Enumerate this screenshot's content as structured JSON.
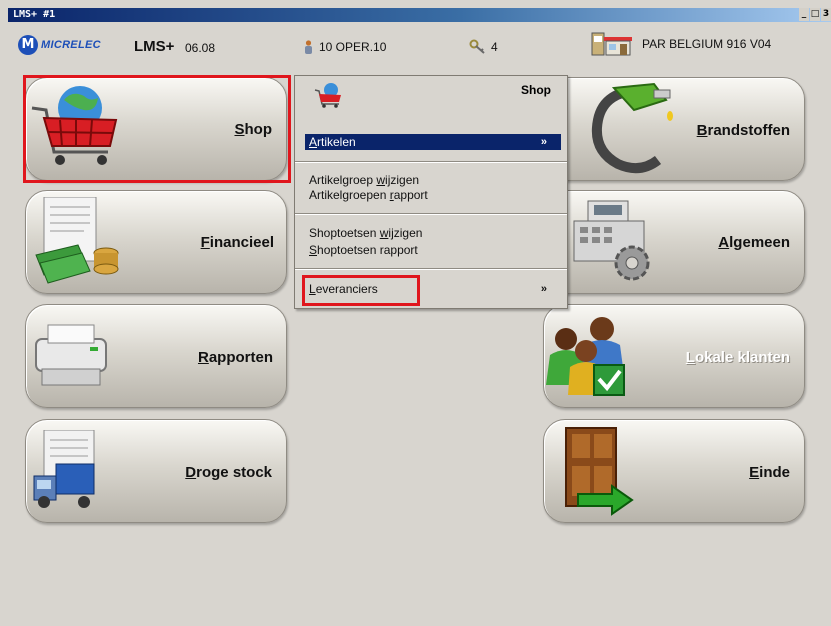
{
  "window": {
    "title": "LMS+  #1",
    "controls": [
      "_",
      "&",
      "3"
    ]
  },
  "header": {
    "logo_text": "MICRELEC",
    "app_name": "LMS+",
    "app_version": "06.08",
    "operator": "10  OPER.10",
    "key_count": "4",
    "station": "PAR BELGIUM 916 V04"
  },
  "tiles": {
    "shop": {
      "prefix": "",
      "ul": "S",
      "rest": "hop"
    },
    "financieel": {
      "prefix": "",
      "ul": "F",
      "rest": "inancieel"
    },
    "rapporten": {
      "prefix": "",
      "ul": "R",
      "rest": "apporten"
    },
    "droge_stock": {
      "prefix": "",
      "ul": "D",
      "rest": "roge stock"
    },
    "brandstoffen": {
      "prefix": "",
      "ul": "B",
      "rest": "randstoffen"
    },
    "algemeen": {
      "prefix": "",
      "ul": "A",
      "rest": "lgemeen"
    },
    "lokale_klanten": {
      "prefix": "",
      "ul": "L",
      "rest": "okale klanten"
    },
    "einde": {
      "prefix": "",
      "ul": "E",
      "rest": "inde"
    }
  },
  "menu": {
    "title": "Shop",
    "items": [
      {
        "ul": "A",
        "rest": "rtikelen",
        "arrow": "»"
      },
      {
        "pre": "Artikelgroep ",
        "ul": "w",
        "rest": "ijzigen"
      },
      {
        "pre": "Artikelgroepen ",
        "ul": "r",
        "rest": "apport"
      },
      {
        "pre": "Shoptoetsen ",
        "ul": "w",
        "rest": "ijzigen"
      },
      {
        "pre": "",
        "ul": "S",
        "rest": "hoptoetsen rapport"
      },
      {
        "ul": "L",
        "rest": "everanciers",
        "arrow": "»"
      }
    ]
  },
  "colors": {
    "highlight": "#e0161d",
    "selection": "#0a246a",
    "brand": "#1d4fb8"
  }
}
